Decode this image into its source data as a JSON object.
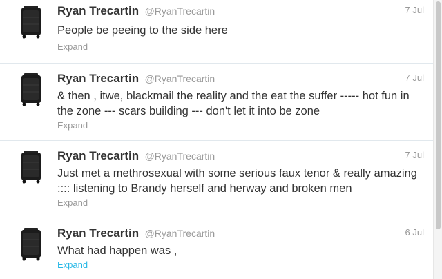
{
  "tweets": [
    {
      "fullname": "Ryan Trecartin",
      "username": "@RyanTrecartin",
      "timestamp": "7 Jul",
      "text": "People be peeing to the side here",
      "expand": "Expand",
      "avatar_icon": "rolling-suitcase-icon"
    },
    {
      "fullname": "Ryan Trecartin",
      "username": "@RyanTrecartin",
      "timestamp": "7 Jul",
      "text": "& then , itwe, blackmail the reality and the eat the suffer ----- hot fun in the zone --- scars building --- don't let it into be zone",
      "expand": "Expand",
      "avatar_icon": "rolling-suitcase-icon"
    },
    {
      "fullname": "Ryan Trecartin",
      "username": "@RyanTrecartin",
      "timestamp": "7 Jul",
      "text": "Just met a methrosexual with some serious faux tenor & really amazing :::: listening to Brandy herself and herway and broken men",
      "expand": "Expand",
      "avatar_icon": "rolling-suitcase-icon"
    },
    {
      "fullname": "Ryan Trecartin",
      "username": "@RyanTrecartin",
      "timestamp": "6 Jul",
      "text": "What had happen was ,",
      "expand": "Expand",
      "avatar_icon": "rolling-suitcase-icon"
    }
  ],
  "colors": {
    "name": "#333333",
    "meta": "#999999",
    "link_active": "#27b8e6",
    "divider": "#e1e8ed"
  }
}
